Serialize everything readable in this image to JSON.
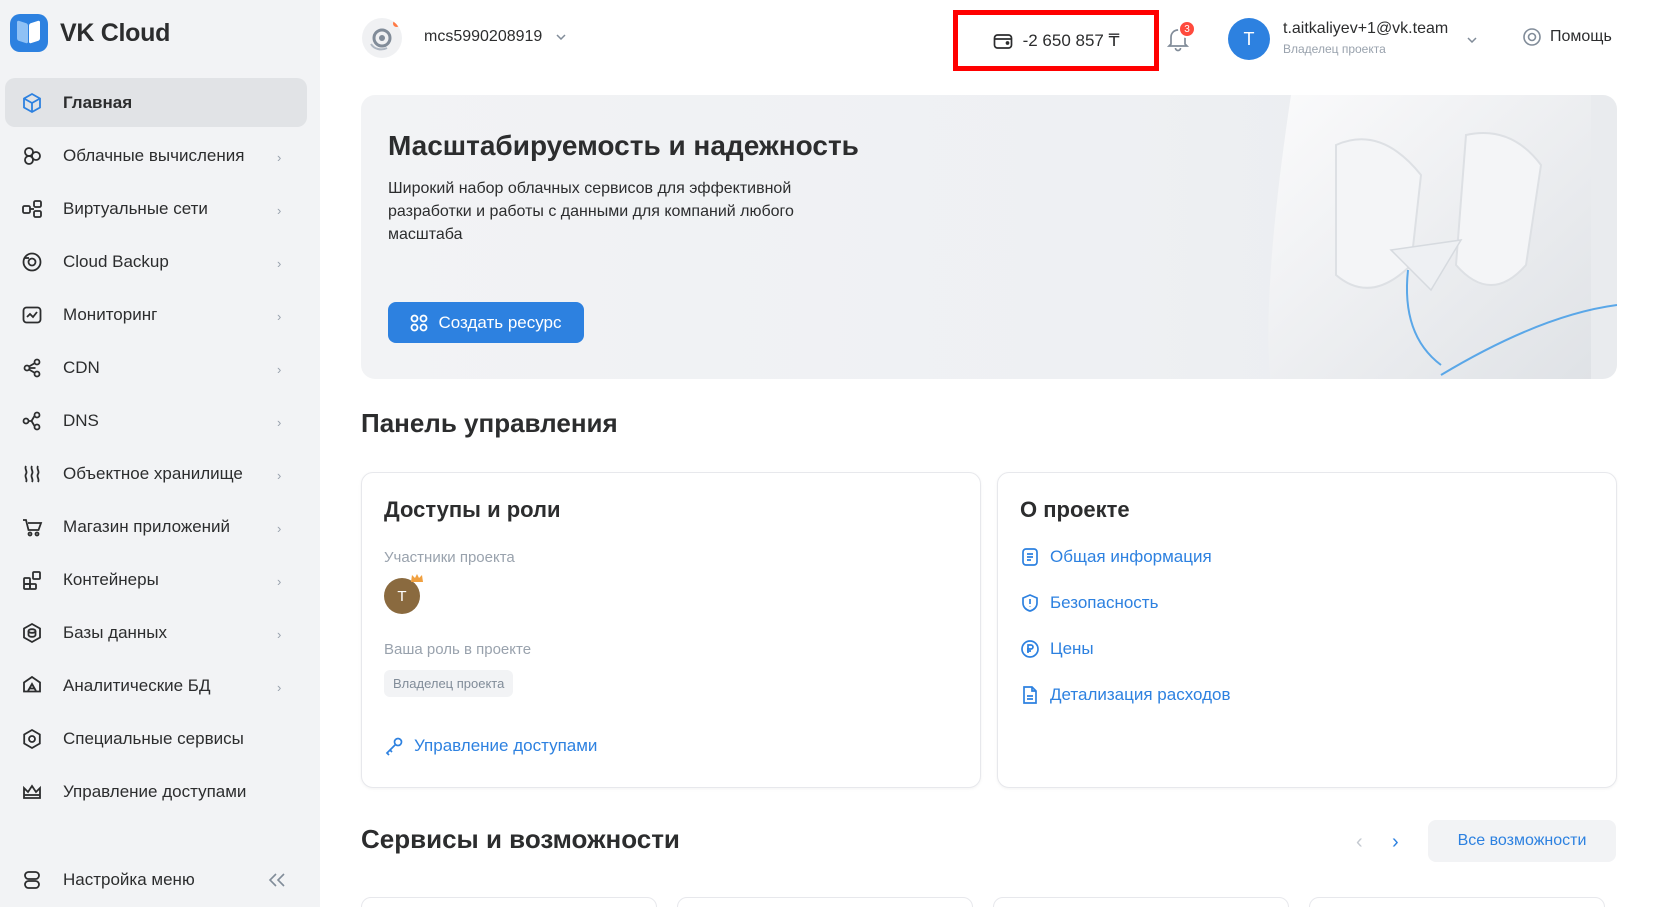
{
  "brand": {
    "name": "VK Cloud"
  },
  "sidebar": {
    "items": [
      {
        "label": "Главная",
        "icon": "cube-icon",
        "active": true
      },
      {
        "label": "Облачные вычисления",
        "icon": "compute-icon"
      },
      {
        "label": "Виртуальные сети",
        "icon": "network-icon"
      },
      {
        "label": "Cloud Backup",
        "icon": "backup-icon"
      },
      {
        "label": "Мониторинг",
        "icon": "monitoring-icon"
      },
      {
        "label": "CDN",
        "icon": "cdn-icon"
      },
      {
        "label": "DNS",
        "icon": "dns-icon"
      },
      {
        "label": "Объектное хранилище",
        "icon": "storage-icon"
      },
      {
        "label": "Магазин приложений",
        "icon": "store-icon"
      },
      {
        "label": "Контейнеры",
        "icon": "containers-icon"
      },
      {
        "label": "Базы данных",
        "icon": "database-icon"
      },
      {
        "label": "Аналитические БД",
        "icon": "analytics-db-icon"
      },
      {
        "label": "Специальные сервисы",
        "icon": "gear-icon"
      },
      {
        "label": "Управление доступами",
        "icon": "crown-icon"
      }
    ],
    "menu_settings": "Настройка меню"
  },
  "topbar": {
    "project_id": "mcs5990208919",
    "balance": "-2 650 857 ₸",
    "notifications_count": "3",
    "user_initial": "T",
    "user_email": "t.aitkaliyev+1@vk.team",
    "user_role": "Владелец проекта",
    "help": "Помощь"
  },
  "banner": {
    "title": "Масштабируемость и надежность",
    "text": "Широкий набор облачных сервисов для эффективной разработки и работы с данными для компаний любого масштаба",
    "button": "Создать ресурс"
  },
  "dashboard": {
    "title": "Панель управления",
    "access_card": {
      "title": "Доступы и роли",
      "members_label": "Участники проекта",
      "member_initial": "T",
      "role_label": "Ваша роль в проекте",
      "role_value": "Владелец проекта",
      "manage_link": "Управление доступами"
    },
    "project_card": {
      "title": "О проекте",
      "links": [
        {
          "label": "Общая информация",
          "icon": "document-icon"
        },
        {
          "label": "Безопасность",
          "icon": "shield-icon"
        },
        {
          "label": "Цены",
          "icon": "ruble-icon"
        },
        {
          "label": "Детализация расходов",
          "icon": "report-icon"
        }
      ]
    }
  },
  "services": {
    "title": "Сервисы и возможности",
    "all_button": "Все возможности"
  },
  "colors": {
    "accent": "#2d81e0",
    "highlight": "#ff0000",
    "sidebar_bg": "#f2f3f5"
  }
}
